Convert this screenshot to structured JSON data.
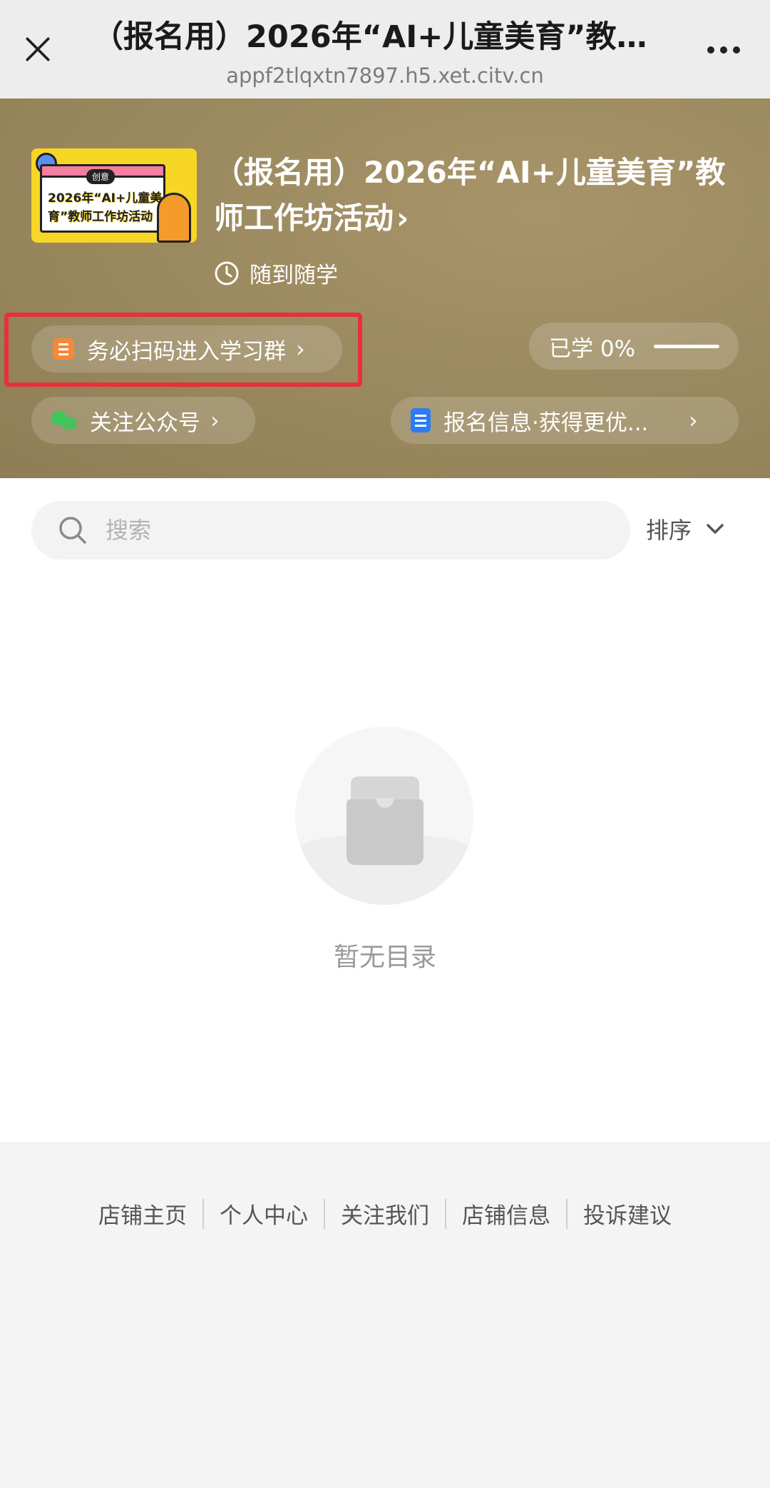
{
  "browser": {
    "title": "（报名用）2026年“AI+儿童美育”教师...",
    "url": "appf2tlqxtn7897.h5.xet.citv.cn",
    "close_icon": "close-icon",
    "more_icon": "more-dots-icon"
  },
  "course": {
    "title": "（报名用）2026年“AI+儿童美育”教师工作坊活动",
    "title_chevron": "›",
    "learn_mode": "随到随学",
    "cover": {
      "badge": "创意",
      "line1": "2026年“AI+儿童美",
      "line2": "育”教师工作坊活动"
    }
  },
  "actions": {
    "scan_group": "务必扫码进入学习群",
    "progress_label": "已学 0%",
    "progress_value": 0,
    "follow_account": "关注公众号",
    "signup_info": "报名信息·获得更优..."
  },
  "search": {
    "placeholder": "搜索",
    "value": "",
    "sort_label": "排序"
  },
  "catalog": {
    "empty_text": "暂无目录"
  },
  "footer": {
    "links": [
      "店铺主页",
      "个人中心",
      "关注我们",
      "店铺信息",
      "投诉建议"
    ]
  },
  "colors": {
    "hero_bg": "#9c8a60",
    "highlight_border": "#e6313b",
    "scan_icon": "#f7883a",
    "wechat_icon": "#3cc75a",
    "doc_icon": "#2d7cf5"
  }
}
